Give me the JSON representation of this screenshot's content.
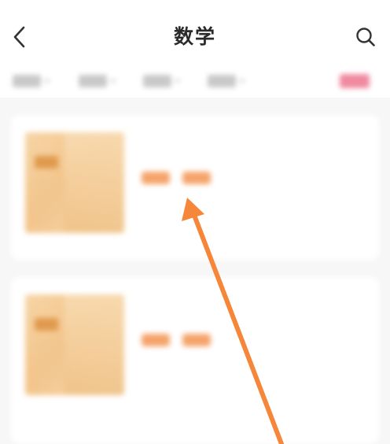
{
  "header": {
    "title": "数学",
    "back_icon": "chevron-left-icon",
    "search_icon": "search-icon"
  },
  "filter_bar": {
    "chips": [
      "",
      "",
      "",
      ""
    ],
    "action_label": "",
    "action_color": "#f08aa0"
  },
  "list": {
    "items": [
      {
        "title": "",
        "tags": [
          "",
          ""
        ],
        "meta_line_1": "",
        "meta_line_2": ""
      },
      {
        "title": "",
        "tags": [
          "",
          ""
        ],
        "meta_line_1": "",
        "meta_line_2": ""
      }
    ]
  },
  "annotation": {
    "arrow_color": "#f5863a",
    "icon": "arrow-pointer-icon"
  }
}
